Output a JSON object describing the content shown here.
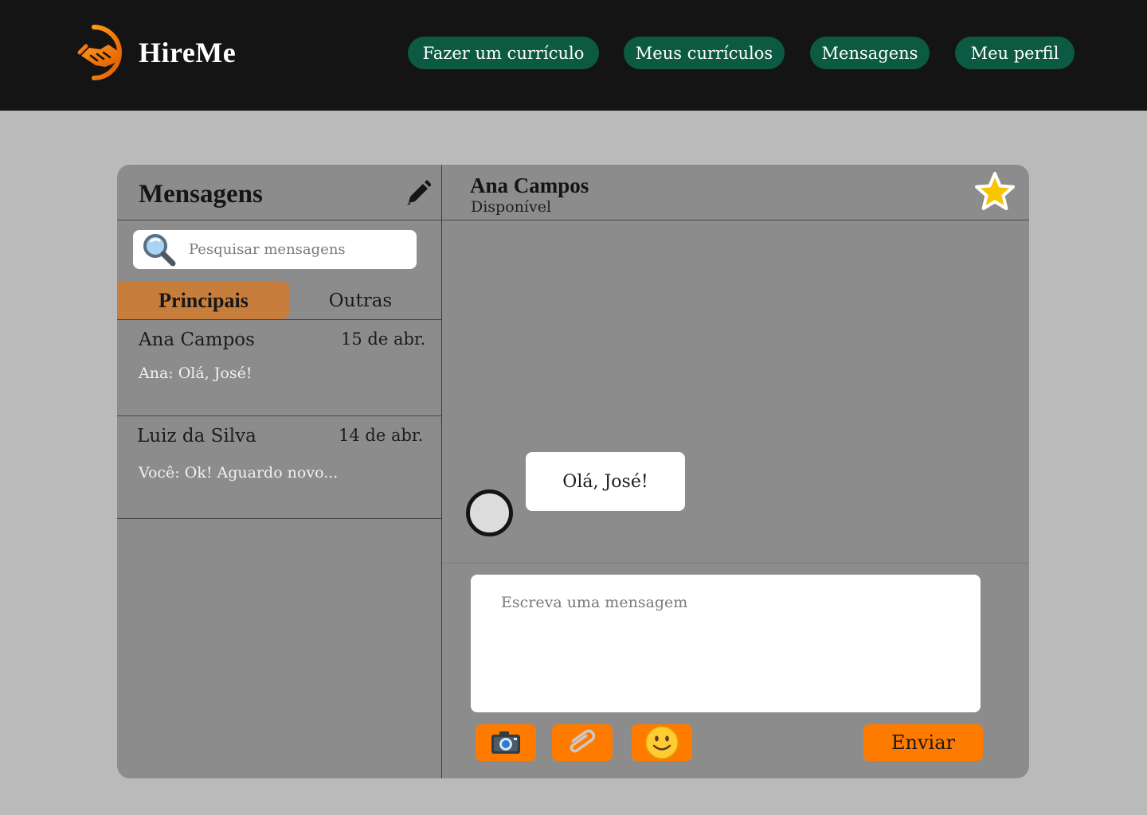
{
  "brand": {
    "name": "HireMe"
  },
  "nav": {
    "items": [
      {
        "label": "Fazer um currículo"
      },
      {
        "label": "Meus currículos"
      },
      {
        "label": "Mensagens"
      },
      {
        "label": "Meu perfil"
      }
    ]
  },
  "sidebar": {
    "title": "Mensagens",
    "search_placeholder": "Pesquisar mensagens",
    "tabs": [
      {
        "label": "Principais",
        "active": true
      },
      {
        "label": "Outras",
        "active": false
      }
    ],
    "conversations": [
      {
        "name": "Ana Campos",
        "date": "15  de abr.",
        "preview": "Ana: Olá, José!"
      },
      {
        "name": "Luiz da Silva",
        "date": "14 de abr.",
        "preview": "Você: Ok! Aguardo novo..."
      }
    ]
  },
  "chat": {
    "contact_name": "Ana Campos",
    "contact_status": "Disponível",
    "messages": [
      {
        "text": "Olá, José!",
        "from": "contact"
      }
    ],
    "compose_placeholder": "Escreva uma mensagem",
    "send_label": "Enviar",
    "tools": [
      "camera-icon",
      "paperclip-icon",
      "smiley-icon"
    ]
  },
  "colors": {
    "topbar": "#141414",
    "nav_button": "#0b5a41",
    "page_bg": "#bababa",
    "panel_bg": "#8c8c8c",
    "active_tab": "#c77d3c",
    "action_orange": "#ff7b00",
    "star": "#f9c400"
  }
}
